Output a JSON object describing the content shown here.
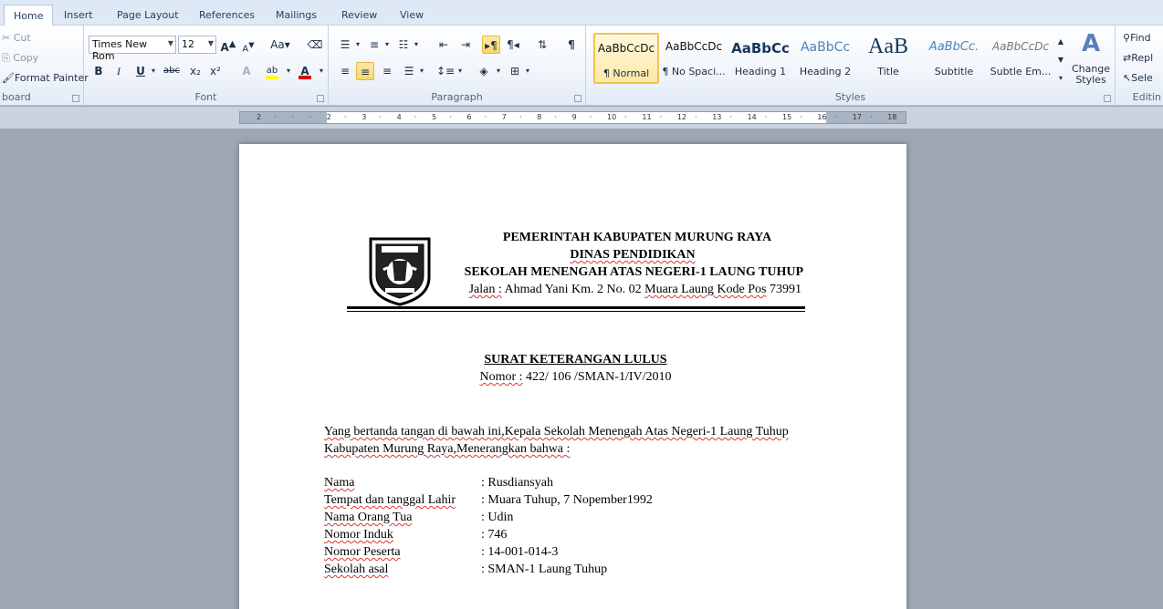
{
  "tabs": [
    {
      "label": "Home",
      "active": true
    },
    {
      "label": "Insert"
    },
    {
      "label": "Page Layout"
    },
    {
      "label": "References"
    },
    {
      "label": "Mailings"
    },
    {
      "label": "Review"
    },
    {
      "label": "View"
    }
  ],
  "clipboard": {
    "cut": "Cut",
    "copy": "Copy",
    "format_painter": "Format Painter",
    "label": "board"
  },
  "font": {
    "family": "Times New Rom",
    "size": "12",
    "label": "Font",
    "bold": "B",
    "italic": "I",
    "underline": "U",
    "strike": "abc",
    "subscript": "x₂",
    "superscript": "x²",
    "aa": "Aa",
    "grow": "A",
    "shrink": "A",
    "highlight": "ab",
    "color": "A",
    "highlight_color": "#ffff00",
    "font_color": "#e00000"
  },
  "paragraph": {
    "label": "Paragraph"
  },
  "styles": {
    "label": "Styles",
    "items": [
      {
        "preview": "AaBbCcDc",
        "name": "¶ Normal",
        "selected": true
      },
      {
        "preview": "AaBbCcDc",
        "name": "¶ No Spaci..."
      },
      {
        "preview": "AaBbCc",
        "name": "Heading 1"
      },
      {
        "preview": "AaBbCc",
        "name": "Heading 2"
      },
      {
        "preview": "AaB",
        "name": "Title"
      },
      {
        "preview": "AaBbCc.",
        "name": "Subtitle"
      },
      {
        "preview": "AaBbCcDc",
        "name": "Subtle Em..."
      }
    ],
    "change_styles": "Change Styles"
  },
  "editing": {
    "label": "Editin",
    "find": "Find",
    "replace": "Repl",
    "select": "Sele"
  },
  "ruler": {
    "ticks": [
      "2",
      "1",
      "1",
      "1",
      "2",
      "1",
      "3",
      "1",
      "4",
      "1",
      "5",
      "1",
      "6",
      "1",
      "7",
      "1",
      "8",
      "1",
      "9",
      "1",
      "10",
      "1",
      "11",
      "1",
      "12",
      "1",
      "13",
      "1",
      "14",
      "1",
      "15",
      "1",
      "16",
      "1",
      "17",
      "1",
      "18"
    ]
  },
  "document": {
    "header": {
      "line1": "PEMERINTAH  KABUPATEN  MURUNG  RAYA",
      "line2": "DINAS  PENDIDIKAN",
      "line3": "SEKOLAH  MENENGAH  ATAS NEGERI-1  LAUNG  TUHUP",
      "line4_a": "Jalan :",
      "line4_b": " Ahmad Yani   Km. 2  No. 02 ",
      "line4_c": "Muara Laung Kode Pos",
      "line4_d": " 73991"
    },
    "title": "SURAT  KETERANGAN  LULUS",
    "number_label": "Nomor :",
    "number_value": " 422/ 106 /SMAN-1/IV/2010",
    "intro_line1": "Yang  bertanda tangan di bawah ini,Kepala  Sekolah Menengah Atas Negeri-1 Laung  Tuhup",
    "intro_line2": "Kabupaten  Murung Raya,Menerangkan  bahwa :",
    "fields": [
      {
        "label": "Nama",
        "value": ": Rusdiansyah"
      },
      {
        "label": "Tempat dan tanggal Lahir",
        "value": ": Muara Tuhup, 7 Nopember1992"
      },
      {
        "label": "Nama Orang Tua",
        "value": ": Udin"
      },
      {
        "label": "Nomor Induk",
        "value": ": 746"
      },
      {
        "label": "Nomor Peserta",
        "value": ": 14-001-014-3"
      },
      {
        "label": "Sekolah asal",
        "value": ": SMAN-1 Laung Tuhup"
      }
    ]
  },
  "colors": {
    "ribbon_bg": "#dfe9f5",
    "workspace": "#9da7b3",
    "selection": "#fde9a6"
  }
}
